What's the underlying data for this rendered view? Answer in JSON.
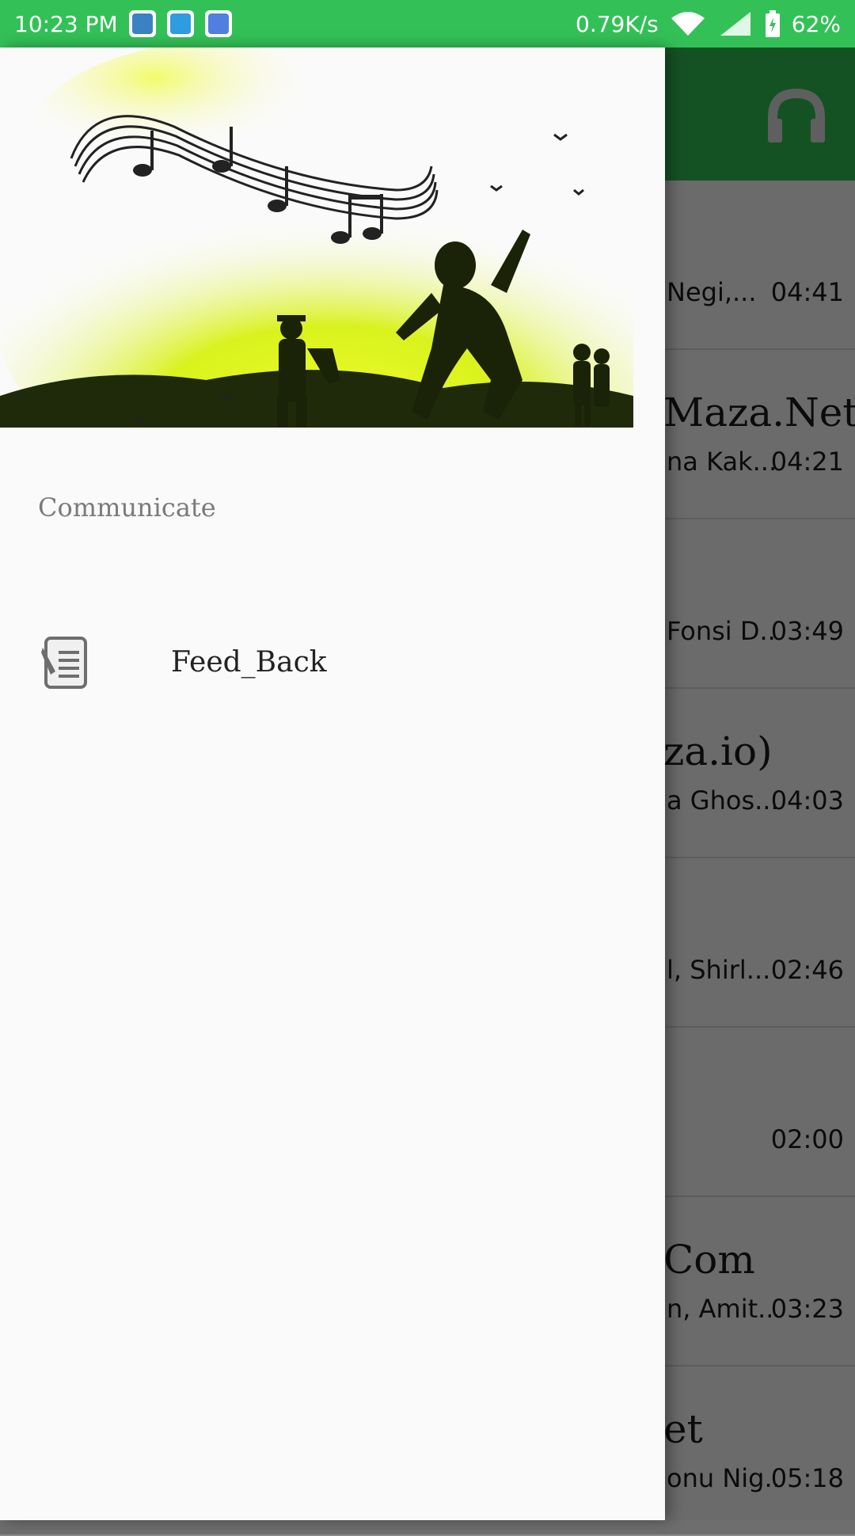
{
  "status_bar": {
    "time": "10:23 PM",
    "net_speed": "0.79K/s",
    "battery": "62%",
    "icons": [
      "usb-icon",
      "file-manager-icon",
      "android-debug-icon",
      "wifi-icon",
      "signal-icon",
      "battery-icon"
    ]
  },
  "drawer": {
    "section_title": "Communicate",
    "items": [
      {
        "label": "Feed_Back",
        "icon": "feedback-icon"
      }
    ]
  },
  "background_list": {
    "rows": [
      {
        "title": "",
        "subtitle": "Negi,...",
        "duration": "04:41"
      },
      {
        "title": "Maza.Net",
        "subtitle": "na Kak...",
        "duration": "04:21"
      },
      {
        "title": "",
        "subtitle": "Fonsi D...",
        "duration": "03:49"
      },
      {
        "title": "za.io)",
        "subtitle": "a Ghos...",
        "duration": "04:03"
      },
      {
        "title": "",
        "subtitle": "l, Shirl...",
        "duration": "02:46"
      },
      {
        "title": "",
        "subtitle": "",
        "duration": "02:00"
      },
      {
        "title": "Com",
        "subtitle": "n, Amit...",
        "duration": "03:23"
      },
      {
        "title": "et",
        "subtitle": "onu Nig...",
        "duration": "05:18"
      }
    ]
  },
  "colors": {
    "status_bar": "#33c157",
    "app_bar": "#1f7a34",
    "drawer_bg": "#fafafa",
    "header_glow": "#d9f21e"
  }
}
